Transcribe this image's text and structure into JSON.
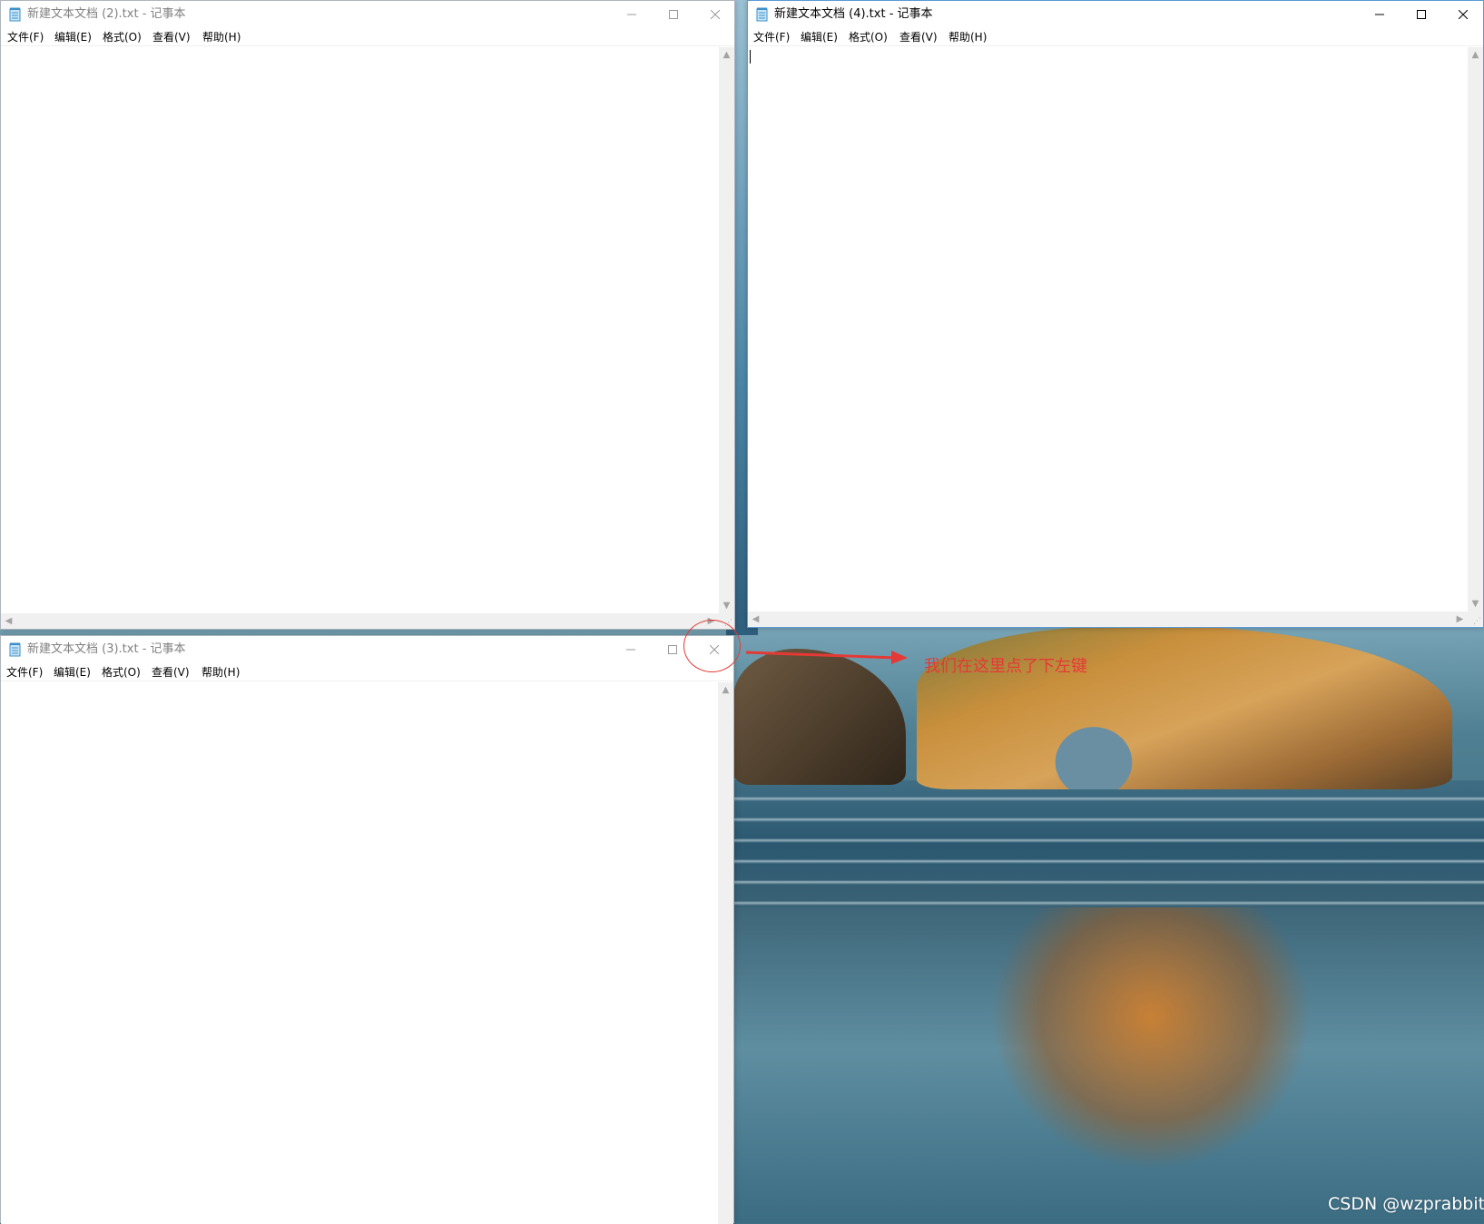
{
  "windows": [
    {
      "id": "notepad-2",
      "title": "新建文本文档 (2).txt - 记事本",
      "state": "inactive",
      "menu": [
        "文件(F)",
        "编辑(E)",
        "格式(O)",
        "查看(V)",
        "帮助(H)"
      ],
      "content": ""
    },
    {
      "id": "notepad-4",
      "title": "新建文本文档 (4).txt - 记事本",
      "state": "active",
      "menu": [
        "文件(F)",
        "编辑(E)",
        "格式(O)",
        "查看(V)",
        "帮助(H)"
      ],
      "content": ""
    },
    {
      "id": "notepad-3",
      "title": "新建文本文档 (3).txt - 记事本",
      "state": "inactive",
      "menu": [
        "文件(F)",
        "编辑(E)",
        "格式(O)",
        "查看(V)",
        "帮助(H)"
      ],
      "content": ""
    }
  ],
  "icons": {
    "app": "notepad-icon",
    "minimize": "minimize-icon",
    "maximize": "maximize-icon",
    "close": "close-icon"
  },
  "annotation": {
    "text": "我们在这里点了下左键",
    "color": "#e53935"
  },
  "watermark": "CSDN @wzprabbit"
}
